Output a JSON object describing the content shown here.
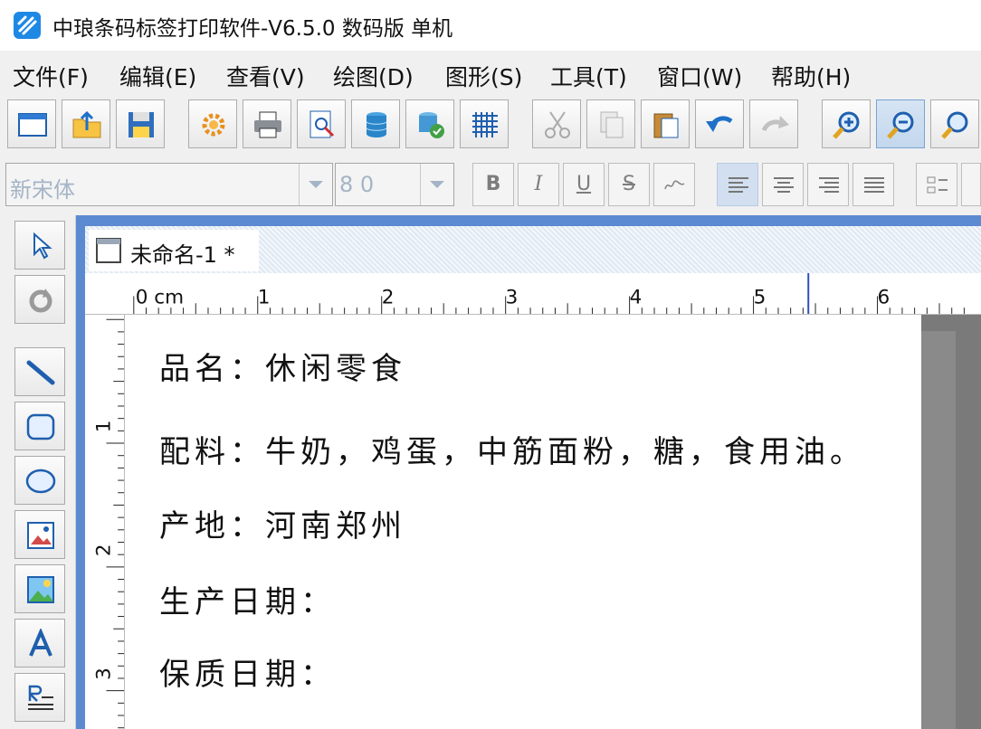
{
  "window": {
    "title": "中琅条码标签打印软件-V6.5.0 数码版 单机"
  },
  "menu": [
    {
      "label": "文件(F)"
    },
    {
      "label": "编辑(E)"
    },
    {
      "label": "查看(V)"
    },
    {
      "label": "绘图(D)"
    },
    {
      "label": "图形(S)"
    },
    {
      "label": "工具(T)"
    },
    {
      "label": "窗口(W)"
    },
    {
      "label": "帮助(H)"
    }
  ],
  "toolbar": {
    "buttons": [
      "new-icon",
      "open-icon",
      "save-icon",
      "settings-gear-icon",
      "print-icon",
      "print-preview-icon",
      "database-icon",
      "database-connect-icon",
      "grid-icon",
      "cut-icon",
      "copy-icon",
      "paste-icon",
      "undo-icon",
      "redo-icon",
      "zoom-in-icon",
      "zoom-out-icon",
      "zoom-fit-icon"
    ]
  },
  "format": {
    "font_name": "新宋体",
    "font_size": "8 0",
    "bold": "B",
    "italic": "I",
    "underline": "U",
    "strike": "S"
  },
  "colors": {
    "accent": "#5b8ad1",
    "disabled_text": "#a5b4c6"
  },
  "document": {
    "tab_label": "未命名-1 *"
  },
  "ruler": {
    "h_unit_label": "0 cm",
    "h_labels": [
      "1",
      "2",
      "3",
      "4",
      "5",
      "6"
    ],
    "v_labels": [
      "1",
      "2",
      "3"
    ]
  },
  "label": {
    "lines": [
      "品名：休闲零食",
      "配料：牛奶，鸡蛋，中筋面粉，糖，食用油。",
      "产地：河南郑州",
      "生产日期：",
      "保质日期："
    ]
  }
}
